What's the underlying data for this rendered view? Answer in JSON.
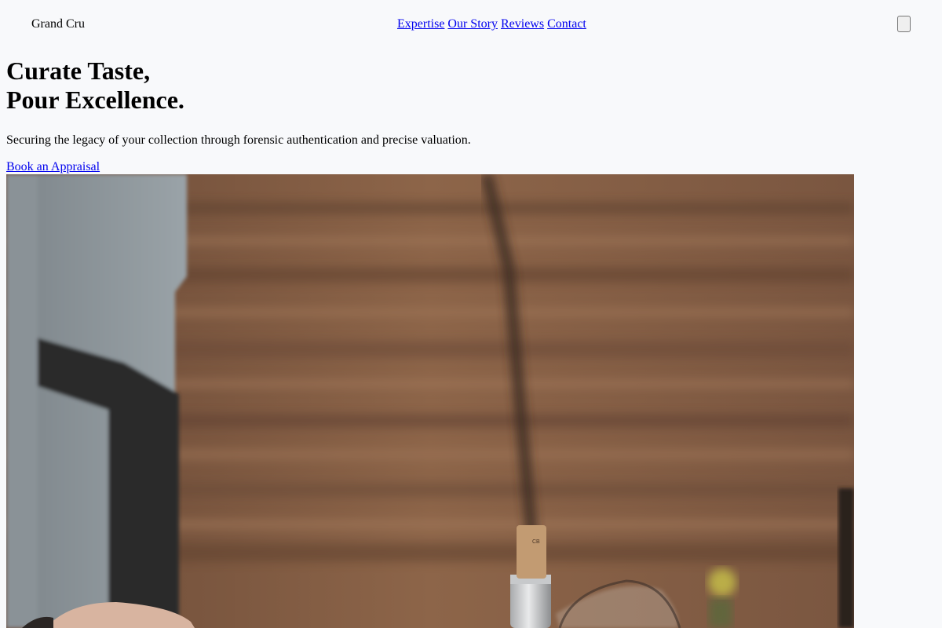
{
  "header": {
    "brand": "Grand Cru",
    "nav": [
      {
        "label": "Expertise"
      },
      {
        "label": "Our Story"
      },
      {
        "label": "Reviews"
      },
      {
        "label": "Contact"
      }
    ]
  },
  "hero": {
    "title_line1": "Curate Taste,",
    "title_line2": "Pour Excellence.",
    "subtitle": "Securing the legacy of your collection through forensic authentication and precise valuation.",
    "cta_label": "Book an Appraisal"
  },
  "colors": {
    "background": "#f8f9fb",
    "link": "#0000ee",
    "wall_wood": "#8a6248"
  }
}
